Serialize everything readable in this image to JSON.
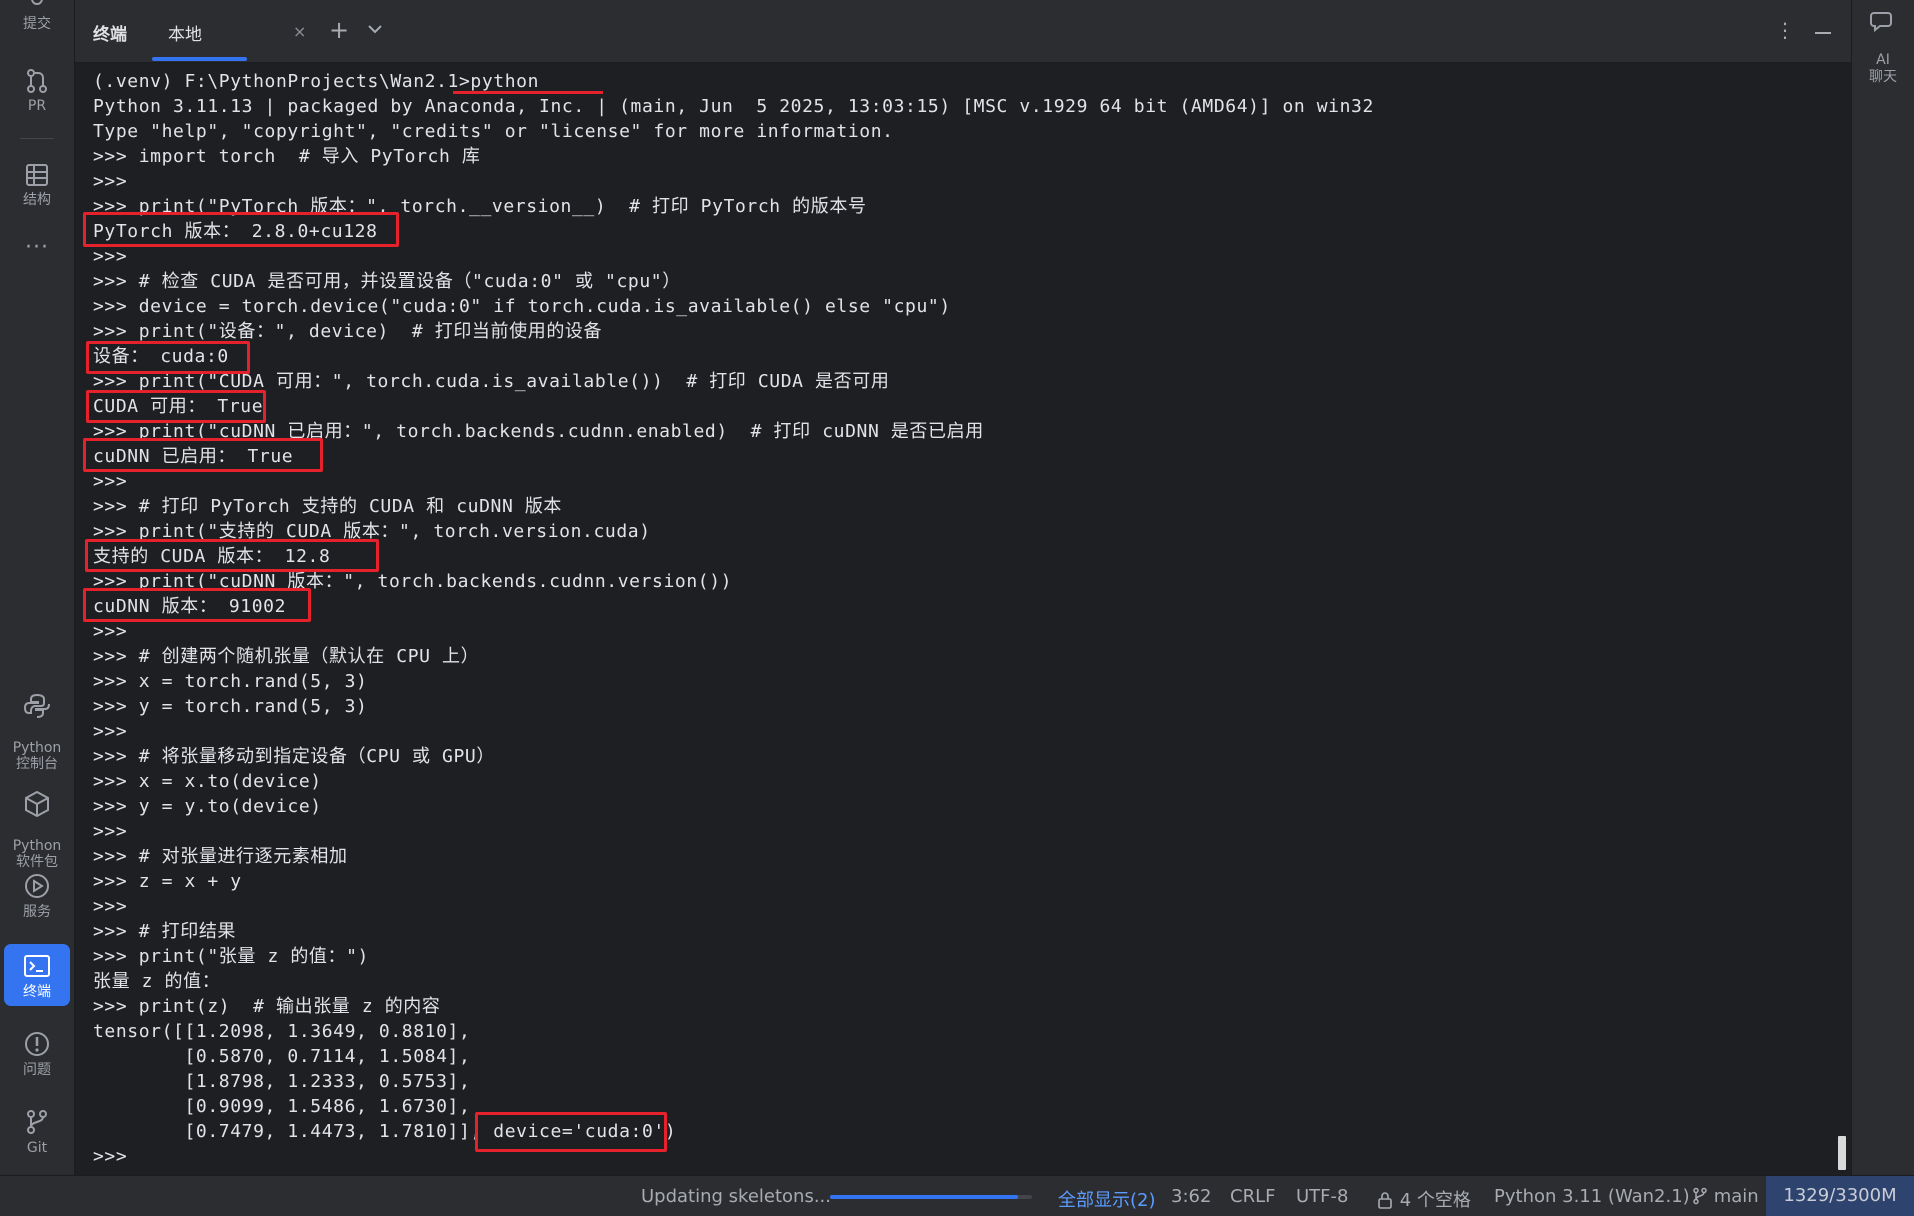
{
  "sidebar": {
    "items": [
      {
        "label": "提交",
        "icon": "commit-icon"
      },
      {
        "label": "PR",
        "icon": "pull-request-icon"
      },
      {
        "label": "结构",
        "icon": "structure-icon"
      },
      {
        "label": "···",
        "icon": "more-icon"
      },
      {
        "label": "Python\n控制台",
        "icon": "python-console-icon"
      },
      {
        "label": "Python\n软件包",
        "icon": "python-packages-icon"
      },
      {
        "label": "服务",
        "icon": "services-icon"
      },
      {
        "label": "终端",
        "icon": "terminal-icon"
      },
      {
        "label": "问题",
        "icon": "problems-icon"
      },
      {
        "label": "Git",
        "icon": "git-icon"
      }
    ],
    "active": "终端"
  },
  "right_bar": {
    "ai_label": "AI\n聊天",
    "icon": "ai-chat-icon"
  },
  "tabs": {
    "title": "终端",
    "local_tab": "本地",
    "close": "×",
    "add": "+"
  },
  "terminal": {
    "lines": [
      "(.venv) F:\\PythonProjects\\Wan2.1>python",
      "Python 3.11.13 | packaged by Anaconda, Inc. | (main, Jun  5 2025, 13:03:15) [MSC v.1929 64 bit (AMD64)] on win32",
      "Type \"help\", \"copyright\", \"credits\" or \"license\" for more information.",
      ">>> import torch  # 导入 PyTorch 库",
      ">>>",
      ">>> print(\"PyTorch 版本：\", torch.__version__)  # 打印 PyTorch 的版本号",
      "PyTorch 版本： 2.8.0+cu128",
      ">>>",
      ">>> # 检查 CUDA 是否可用，并设置设备（\"cuda:0\" 或 \"cpu\"）",
      ">>> device = torch.device(\"cuda:0\" if torch.cuda.is_available() else \"cpu\")",
      ">>> print(\"设备：\", device)  # 打印当前使用的设备",
      "设备： cuda:0",
      ">>> print(\"CUDA 可用：\", torch.cuda.is_available())  # 打印 CUDA 是否可用",
      "CUDA 可用： True",
      ">>> print(\"cuDNN 已启用：\", torch.backends.cudnn.enabled)  # 打印 cuDNN 是否已启用",
      "cuDNN 已启用： True",
      ">>>",
      ">>> # 打印 PyTorch 支持的 CUDA 和 cuDNN 版本",
      ">>> print(\"支持的 CUDA 版本：\", torch.version.cuda)",
      "支持的 CUDA 版本： 12.8",
      ">>> print(\"cuDNN 版本：\", torch.backends.cudnn.version())",
      "cuDNN 版本： 91002",
      ">>>",
      ">>> # 创建两个随机张量（默认在 CPU 上）",
      ">>> x = torch.rand(5, 3)",
      ">>> y = torch.rand(5, 3)",
      ">>>",
      ">>> # 将张量移动到指定设备（CPU 或 GPU）",
      ">>> x = x.to(device)",
      ">>> y = y.to(device)",
      ">>>",
      ">>> # 对张量进行逐元素相加",
      ">>> z = x + y",
      ">>>",
      ">>> # 打印结果",
      ">>> print(\"张量 z 的值：\")",
      "张量 z 的值：",
      ">>> print(z)  # 输出张量 z 的内容",
      "tensor([[1.2098, 1.3649, 0.8810],",
      "        [0.5870, 0.7114, 1.5084],",
      "        [1.8798, 1.2333, 0.5753],",
      "        [0.9099, 1.5486, 1.6730],",
      "        [0.7479, 1.4473, 1.7810]], device='cuda:0')",
      ">>>"
    ],
    "highlight_color": "#e5222b"
  },
  "status": {
    "task": "Updating skeletons...",
    "progress": 0.93,
    "show_all": "全部显示(2)",
    "position": "3:62",
    "line_sep": "CRLF",
    "encoding": "UTF-8",
    "indent": "4 个空格",
    "interpreter": "Python 3.11 (Wan2.1)",
    "branch": "main",
    "memory": "1329/3300M"
  },
  "colors": {
    "accent": "#3574f0",
    "panel": "#2b2d30",
    "terminal_bg": "#1e1f22",
    "link": "#5c9bff"
  }
}
